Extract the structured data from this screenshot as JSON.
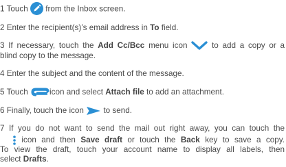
{
  "colors": {
    "text": "#4a4a4a",
    "icon_blue": "#2a8fd4"
  },
  "steps": {
    "s1": {
      "num": "1",
      "a": "Touch",
      "b": "from the Inbox screen.",
      "icon": "pencil-compose-icon"
    },
    "s2": {
      "num": "2",
      "a": "Enter the recipient(s)’s email address in",
      "bold": "To",
      "b": "field."
    },
    "s3": {
      "num": "3",
      "a": "If necessary, touch the",
      "bold": "Add Cc/Bcc",
      "b": "menu icon",
      "c": "to add a copy or a",
      "line2": "blind copy to the message.",
      "icon": "chevron-down-icon"
    },
    "s4": {
      "num": "4",
      "a": "Enter the subject and the content of the message."
    },
    "s5": {
      "num": "5",
      "a": "Touch",
      "b": "icon and select",
      "bold": "Attach file",
      "c": "to add an attachment.",
      "icon": "paperclip-icon"
    },
    "s6": {
      "num": "6",
      "a": "Finally, touch the icon",
      "b": "to send.",
      "icon": "send-arrow-icon"
    },
    "s7": {
      "num": "7",
      "l1": "If you do not want to send the mail out right away, you can touch the",
      "l2a": "icon and then",
      "l2bold1": "Save draft",
      "l2b": "or touch the",
      "l2bold2": "Back",
      "l2c": "key to save a copy.",
      "l3": "To view the draft, touch your account name to display all labels, then",
      "l4a": "select",
      "l4bold": "Drafts",
      "l4b": ".",
      "icon": "vertical-dots-menu-icon"
    }
  }
}
